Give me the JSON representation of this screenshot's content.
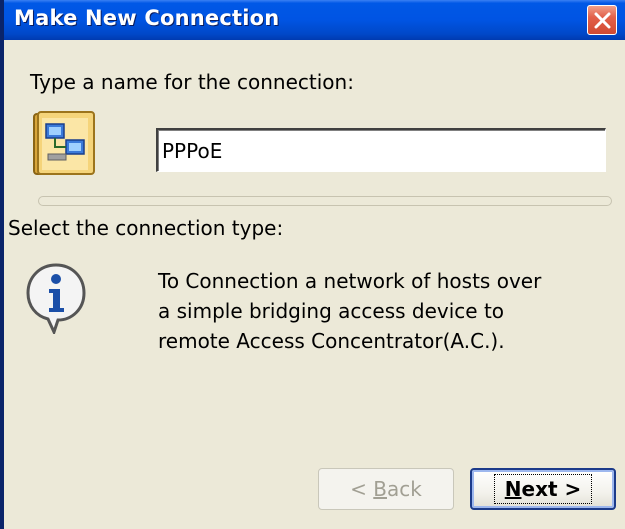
{
  "window": {
    "title": "Make New Connection",
    "close_icon": "close-icon"
  },
  "name_section": {
    "label": "Type a name for the connection:",
    "icon": "network-connection-icon",
    "input_value": "PPPoE"
  },
  "type_section": {
    "label": "Select the connection type:",
    "icon": "info-balloon-icon",
    "description_lines": [
      "To Connection a network of hosts over",
      "a simple bridging access device to",
      "remote Access Concentrator(A.C.)."
    ]
  },
  "buttons": {
    "back_prefix": "< ",
    "back_accel": "B",
    "back_rest": "ack",
    "back_enabled": false,
    "next_accel": "N",
    "next_rest": "ext >",
    "next_enabled": true
  },
  "colors": {
    "titlebar": "#0054e3",
    "window_bg": "#ece9d8",
    "close_button": "#e2604a"
  }
}
